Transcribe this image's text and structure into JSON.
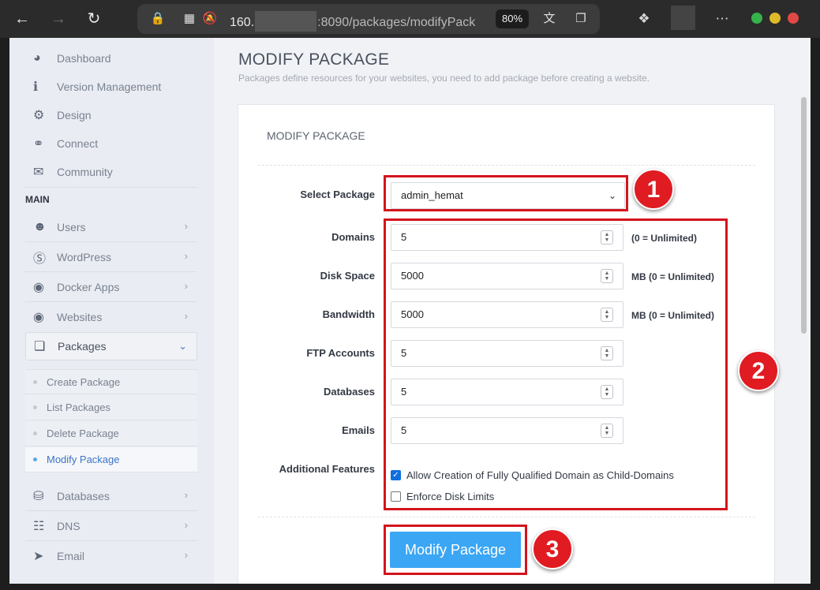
{
  "browser": {
    "url_prefix": "160.",
    "url_suffix": ":8090/packages/modifyPack",
    "zoom": "80%"
  },
  "sidebar": {
    "top_items": [
      {
        "label": "Dashboard",
        "icon": "dashboard-icon"
      },
      {
        "label": "Version Management",
        "icon": "info-icon"
      },
      {
        "label": "Design",
        "icon": "gear-icon"
      },
      {
        "label": "Connect",
        "icon": "link-icon"
      },
      {
        "label": "Community",
        "icon": "chat-icon"
      }
    ],
    "section_heading": "MAIN",
    "main_items": [
      {
        "label": "Users",
        "icon": "users-icon"
      },
      {
        "label": "WordPress",
        "icon": "wordpress-icon"
      },
      {
        "label": "Docker Apps",
        "icon": "globe-icon"
      },
      {
        "label": "Websites",
        "icon": "globe-icon"
      },
      {
        "label": "Packages",
        "icon": "packages-icon"
      }
    ],
    "package_sub_items": [
      "Create Package",
      "List Packages",
      "Delete Package",
      "Modify Package"
    ],
    "lower_items": [
      {
        "label": "Databases",
        "icon": "database-icon"
      },
      {
        "label": "DNS",
        "icon": "sitemap-icon"
      },
      {
        "label": "Email",
        "icon": "paper-plane-icon"
      }
    ]
  },
  "main": {
    "title": "MODIFY PACKAGE",
    "subtitle": "Packages define resources for your websites, you need to add package before creating a website.",
    "card_title": "MODIFY PACKAGE",
    "select_label": "Select Package",
    "selected_package": "admin_hemat",
    "fields": [
      {
        "label": "Domains",
        "value": "5",
        "unit": "(0 = Unlimited)"
      },
      {
        "label": "Disk Space",
        "value": "5000",
        "unit": "MB (0 = Unlimited)"
      },
      {
        "label": "Bandwidth",
        "value": "5000",
        "unit": "MB (0 = Unlimited)"
      },
      {
        "label": "FTP Accounts",
        "value": "5",
        "unit": ""
      },
      {
        "label": "Databases",
        "value": "5",
        "unit": ""
      },
      {
        "label": "Emails",
        "value": "5",
        "unit": ""
      }
    ],
    "features_label": "Additional Features",
    "features": [
      {
        "label": "Allow Creation of Fully Qualified Domain as Child-Domains",
        "checked": true
      },
      {
        "label": "Enforce Disk Limits",
        "checked": false
      }
    ],
    "submit_label": "Modify Package"
  },
  "annotations": [
    "1",
    "2",
    "3"
  ],
  "colors": {
    "annotation_red": "#d4141c",
    "button_blue": "#3ba6f4",
    "active_link": "#3d74c6"
  }
}
